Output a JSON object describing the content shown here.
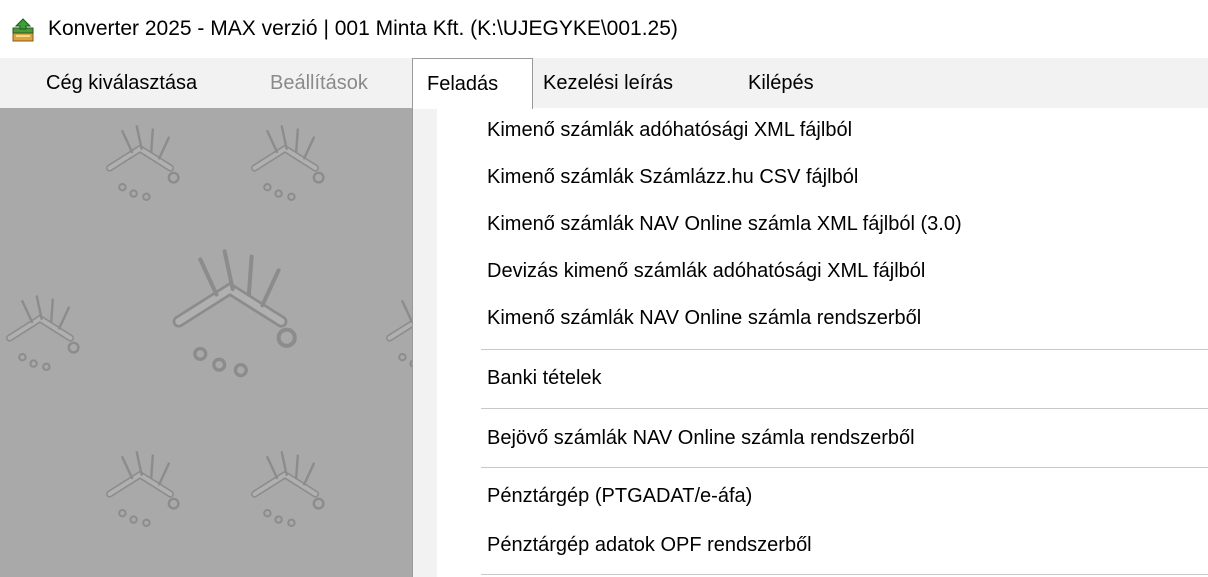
{
  "window": {
    "title": "Konverter 2025 - MAX verzió  | 001 Minta Kft. (K:\\UJEGYKE\\001.25)",
    "icon": "app-stack-icon"
  },
  "menubar": {
    "items": [
      {
        "label": "Cég kiválasztása",
        "state": "normal"
      },
      {
        "label": "Beállítások",
        "state": "disabled"
      },
      {
        "label": "Feladás",
        "state": "open"
      },
      {
        "label": "Kezelési leírás",
        "state": "normal"
      },
      {
        "label": "Kilépés",
        "state": "normal"
      }
    ]
  },
  "dropdown": {
    "items": [
      {
        "label": "Kimenő számlák adóhatósági XML fájlból"
      },
      {
        "label": "Kimenő számlák Számlázz.hu CSV fájlból"
      },
      {
        "label": "Kimenő számlák NAV Online számla XML fájlból (3.0)"
      },
      {
        "label": "Devizás kimenő számlák adóhatósági XML fájlból"
      },
      {
        "label": "Kimenő számlák NAV Online számla rendszerből"
      },
      {
        "label": "Banki tételek"
      },
      {
        "label": "Bejövő számlák NAV Online számla rendszerből"
      },
      {
        "label": "Pénztárgép (PTGADAT/e-áfa)"
      },
      {
        "label": "Pénztárgép adatok OPF rendszerből"
      }
    ]
  },
  "colors": {
    "background_pattern": "#a9a9a9",
    "menu_open_bg": "#ffffff",
    "disabled_text": "#8a8a8a"
  }
}
